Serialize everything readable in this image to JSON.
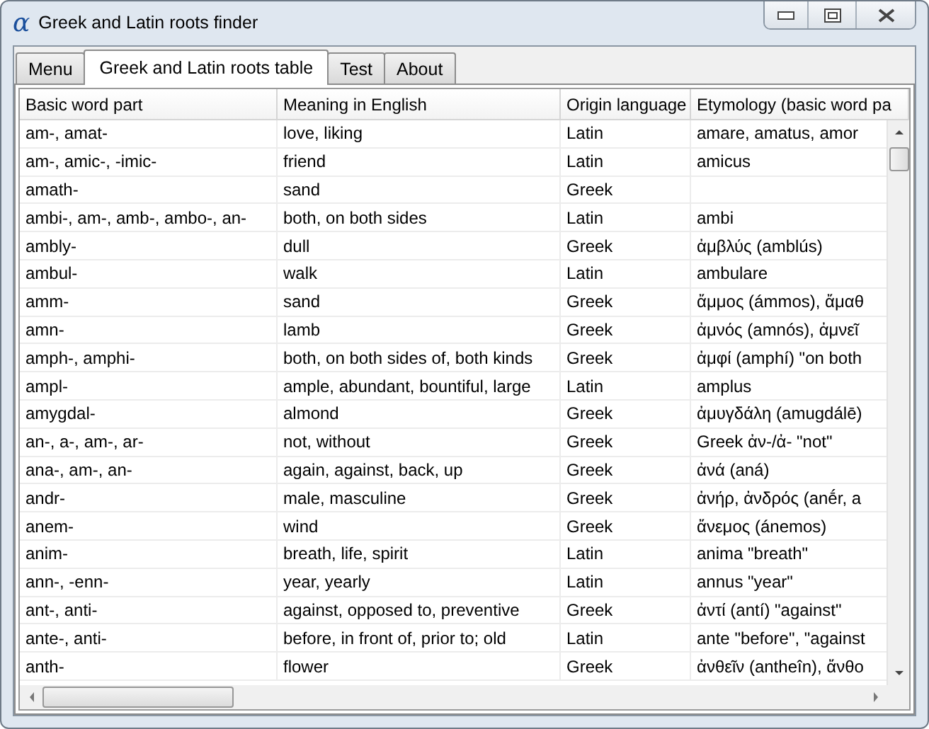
{
  "window": {
    "title": "Greek and Latin roots finder",
    "icon_glyph": "α"
  },
  "tabs": [
    {
      "label": "Menu",
      "selected": false
    },
    {
      "label": "Greek and Latin roots table",
      "selected": true
    },
    {
      "label": "Test",
      "selected": false
    },
    {
      "label": "About",
      "selected": false
    }
  ],
  "table": {
    "columns": [
      "Basic word part",
      "Meaning in English",
      "Origin language",
      "Etymology (basic word pa"
    ],
    "rows": [
      {
        "part": "am-, amat-",
        "meaning": "love, liking",
        "origin": "Latin",
        "etymology": "amare, amatus, amor"
      },
      {
        "part": "am-, amic-, -imic-",
        "meaning": "friend",
        "origin": "Latin",
        "etymology": "amicus"
      },
      {
        "part": "amath-",
        "meaning": "sand",
        "origin": "Greek"
      },
      {
        "part": "ambi-, am-, amb-, ambo-, an-",
        "meaning": "both, on both sides",
        "origin": "Latin",
        "etymology": "ambi"
      },
      {
        "part": "ambly-",
        "meaning": "dull",
        "origin": "Greek",
        "etymology": "ἀμβλύς (amblús)"
      },
      {
        "part": "ambul-",
        "meaning": "walk",
        "origin": "Latin",
        "etymology": "ambulare"
      },
      {
        "part": "amm-",
        "meaning": "sand",
        "origin": "Greek",
        "etymology": "ἄμμος (ámmos), ἄμαθ"
      },
      {
        "part": "amn-",
        "meaning": "lamb",
        "origin": "Greek",
        "etymology": "ἀμνός (amnós), ἀμνεῖ"
      },
      {
        "part": "amph-, amphi-",
        "meaning": "both, on both sides of, both kinds",
        "origin": "Greek",
        "etymology": "ἀμφί (amphí) \"on both"
      },
      {
        "part": "ampl-",
        "meaning": "ample, abundant, bountiful, large",
        "origin": "Latin",
        "etymology": "amplus"
      },
      {
        "part": "amygdal-",
        "meaning": "almond",
        "origin": "Greek",
        "etymology": "ἀμυγδάλη (amugdálē)"
      },
      {
        "part": "an-, a-, am-, ar-",
        "meaning": "not, without",
        "origin": "Greek",
        "etymology": "Greek ἀν-/ἀ- \"not\""
      },
      {
        "part": "ana-, am-, an-",
        "meaning": "again, against, back, up",
        "origin": "Greek",
        "etymology": "ἀνά (aná)"
      },
      {
        "part": "andr-",
        "meaning": "male, masculine",
        "origin": "Greek",
        "etymology": "ἀνήρ, ἀνδρός (anḗr, a"
      },
      {
        "part": "anem-",
        "meaning": "wind",
        "origin": "Greek",
        "etymology": "ἄνεμος (ánemos)"
      },
      {
        "part": "anim-",
        "meaning": "breath, life, spirit",
        "origin": "Latin",
        "etymology": "anima \"breath\""
      },
      {
        "part": "ann-, -enn-",
        "meaning": "year, yearly",
        "origin": "Latin",
        "etymology": "annus \"year\""
      },
      {
        "part": "ant-, anti-",
        "meaning": "against, opposed to, preventive",
        "origin": "Greek",
        "etymology": "ἀντί (antí) \"against\""
      },
      {
        "part": "ante-, anti-",
        "meaning": "before, in front of, prior to; old",
        "origin": "Latin",
        "etymology": "ante \"before\", \"against"
      },
      {
        "part": "anth-",
        "meaning": "flower",
        "origin": "Greek",
        "etymology": "ἀνθεῖν (antheîn), ἄνθο"
      }
    ]
  }
}
